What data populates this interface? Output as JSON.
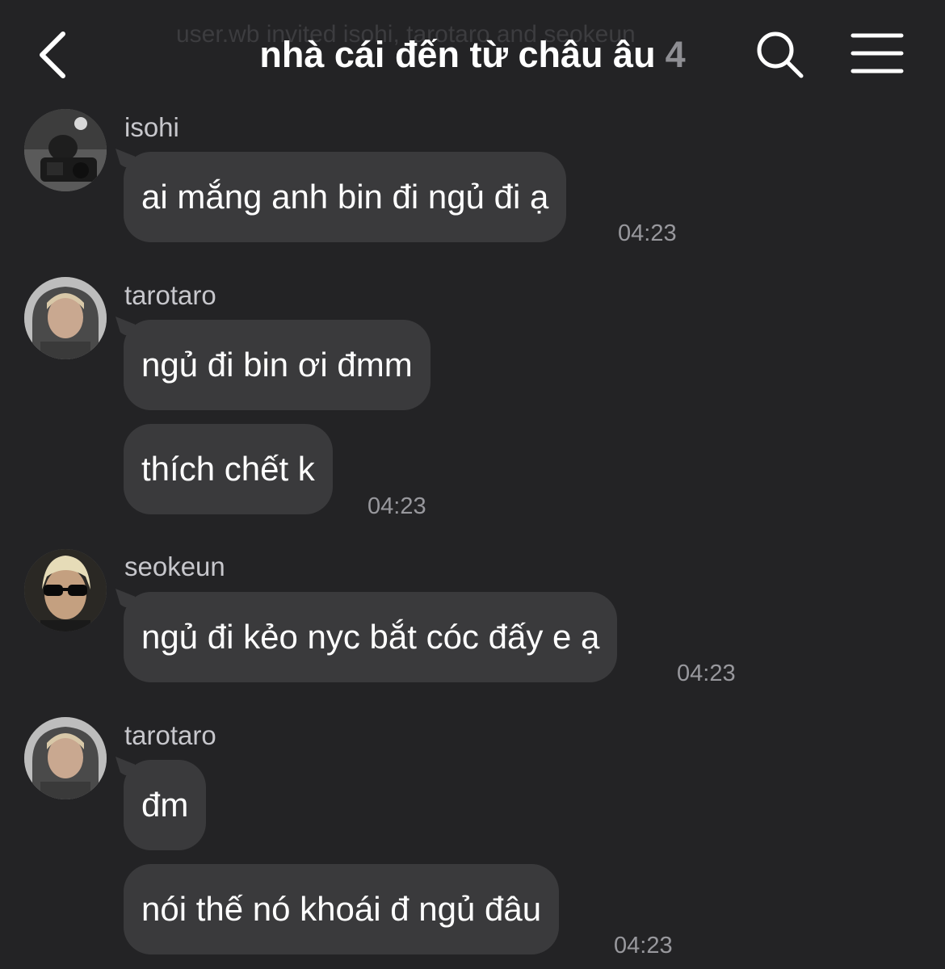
{
  "header": {
    "system_text": "user.wb invited isohi, tarotaro and seokeun",
    "title": "nhà cái đến từ châu âu",
    "member_count": "4"
  },
  "messages": [
    {
      "sender": "isohi",
      "lines": [
        "ai mắng anh bin đi ngủ đi ạ"
      ],
      "time": "04:23"
    },
    {
      "sender": "tarotaro",
      "lines": [
        "ngủ đi bin ơi đmm",
        "thích chết k"
      ],
      "time": "04:23"
    },
    {
      "sender": "seokeun",
      "lines": [
        "ngủ đi kẻo nyc bắt cóc đấy e ạ"
      ],
      "time": "04:23"
    },
    {
      "sender": "tarotaro",
      "lines": [
        "đm",
        "nói thế nó khoái đ ngủ đâu"
      ],
      "time": "04:23"
    }
  ],
  "colors": {
    "background": "#232325",
    "bubble": "#3a3a3c",
    "secondary_text": "#98989d"
  }
}
